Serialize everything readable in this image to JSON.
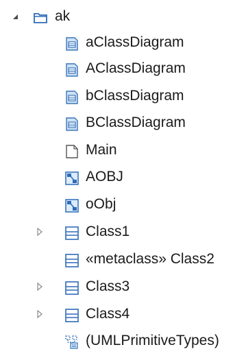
{
  "tree": {
    "root": {
      "label": "ak",
      "expanded": true
    },
    "items": [
      {
        "label": "aClassDiagram",
        "icon": "class-diagram-icon"
      },
      {
        "label": "AClassDiagram",
        "icon": "class-diagram-icon"
      },
      {
        "label": "bClassDiagram",
        "icon": "class-diagram-icon"
      },
      {
        "label": "BClassDiagram",
        "icon": "class-diagram-icon"
      },
      {
        "label": "Main",
        "icon": "blank-document-icon"
      },
      {
        "label": "AOBJ",
        "icon": "object-diagram-icon"
      },
      {
        "label": "oObj",
        "icon": "object-diagram-icon"
      },
      {
        "label": "Class1",
        "icon": "class-icon",
        "expandable": true
      },
      {
        "label": "«metaclass» Class2",
        "icon": "class-icon"
      },
      {
        "label": "Class3",
        "icon": "class-icon",
        "expandable": true
      },
      {
        "label": "Class4",
        "icon": "class-icon",
        "expandable": true
      },
      {
        "label": "(UMLPrimitiveTypes)",
        "icon": "package-import-icon"
      }
    ]
  }
}
